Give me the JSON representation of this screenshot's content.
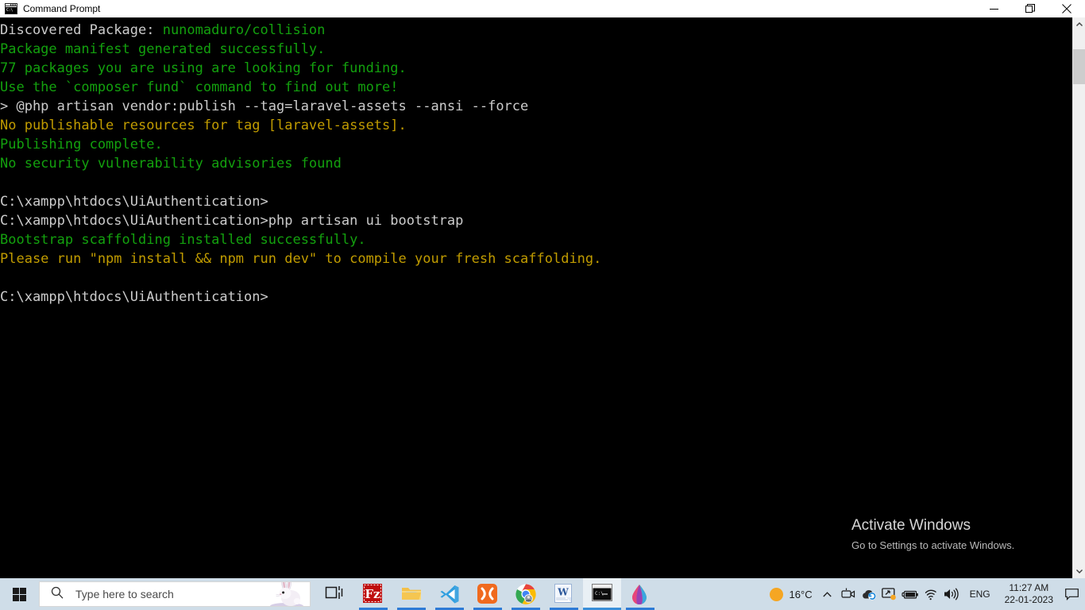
{
  "window": {
    "title": "Command Prompt",
    "icon": "cmd-icon",
    "icon_text": "C:\\",
    "buttons": {
      "minimize": "minimize",
      "restore": "restore",
      "close": "close"
    }
  },
  "console": {
    "lines": [
      {
        "segments": [
          {
            "text": "Discovered Package: ",
            "color": "white"
          },
          {
            "text": "nunomaduro/collision",
            "color": "green"
          }
        ]
      },
      {
        "segments": [
          {
            "text": "Package manifest generated successfully.",
            "color": "green"
          }
        ]
      },
      {
        "segments": [
          {
            "text": "77 packages you are using are looking for funding.",
            "color": "green"
          }
        ]
      },
      {
        "segments": [
          {
            "text": "Use the `composer fund` command to find out more!",
            "color": "green"
          }
        ]
      },
      {
        "segments": [
          {
            "text": "> @php artisan vendor:publish --tag=laravel-assets --ansi --force",
            "color": "white"
          }
        ]
      },
      {
        "segments": [
          {
            "text": "No publishable resources for tag [laravel-assets].",
            "color": "yellow"
          }
        ]
      },
      {
        "segments": [
          {
            "text": "Publishing complete.",
            "color": "green"
          }
        ]
      },
      {
        "segments": [
          {
            "text": "No security vulnerability advisories found",
            "color": "green"
          }
        ]
      },
      {
        "segments": [
          {
            "text": "",
            "color": "white"
          }
        ]
      },
      {
        "segments": [
          {
            "text": "C:\\xampp\\htdocs\\UiAuthentication>",
            "color": "white"
          }
        ]
      },
      {
        "segments": [
          {
            "text": "C:\\xampp\\htdocs\\UiAuthentication>php artisan ui bootstrap",
            "color": "white"
          }
        ]
      },
      {
        "segments": [
          {
            "text": "Bootstrap scaffolding installed successfully.",
            "color": "green"
          }
        ]
      },
      {
        "segments": [
          {
            "text": "Please run \"npm install && npm run dev\" to compile your fresh scaffolding.",
            "color": "yellow"
          }
        ]
      },
      {
        "segments": [
          {
            "text": "",
            "color": "white"
          }
        ]
      },
      {
        "segments": [
          {
            "text": "C:\\xampp\\htdocs\\UiAuthentication>",
            "color": "white"
          }
        ]
      }
    ],
    "colors": {
      "background": "#000000",
      "white": "#cccccc",
      "green": "#13a10e",
      "yellow": "#c19c00"
    }
  },
  "scrollbar": {
    "up_arrow": "chevron-up",
    "down_arrow": "chevron-down"
  },
  "watermark": {
    "title": "Activate Windows",
    "subtitle": "Go to Settings to activate Windows."
  },
  "taskbar": {
    "start": "start-button",
    "search": {
      "placeholder": "Type here to search",
      "icon": "search-icon",
      "decoration": "rabbit-illustration"
    },
    "items": [
      {
        "name": "task-view",
        "label": "Task View",
        "running": false,
        "active": false
      },
      {
        "name": "filezilla",
        "label": "FileZilla",
        "running": true,
        "active": false
      },
      {
        "name": "file-explorer",
        "label": "File Explorer",
        "running": true,
        "active": false
      },
      {
        "name": "visual-studio-code",
        "label": "Visual Studio Code",
        "running": true,
        "active": false
      },
      {
        "name": "xampp",
        "label": "XAMPP Control Panel",
        "running": true,
        "active": false
      },
      {
        "name": "google-chrome",
        "label": "Google Chrome",
        "running": true,
        "active": false
      },
      {
        "name": "microsoft-word",
        "label": "Microsoft Word",
        "running": true,
        "active": false
      },
      {
        "name": "command-prompt",
        "label": "Command Prompt",
        "running": true,
        "active": true
      },
      {
        "name": "paint-3d",
        "label": "Paint 3D",
        "running": true,
        "active": false
      }
    ],
    "tray": {
      "weather_temp": "16°C",
      "weather_icon": "sun-icon",
      "show_hidden_icons": "chevron-up-icon",
      "items": [
        {
          "name": "camera-icon"
        },
        {
          "name": "onedrive-sync-icon"
        },
        {
          "name": "display-settings-icon"
        },
        {
          "name": "battery-icon"
        },
        {
          "name": "wifi-icon"
        },
        {
          "name": "volume-icon"
        }
      ],
      "language": "ENG",
      "time": "11:27 AM",
      "date": "22-01-2023",
      "notifications": "notification-center-icon"
    }
  }
}
